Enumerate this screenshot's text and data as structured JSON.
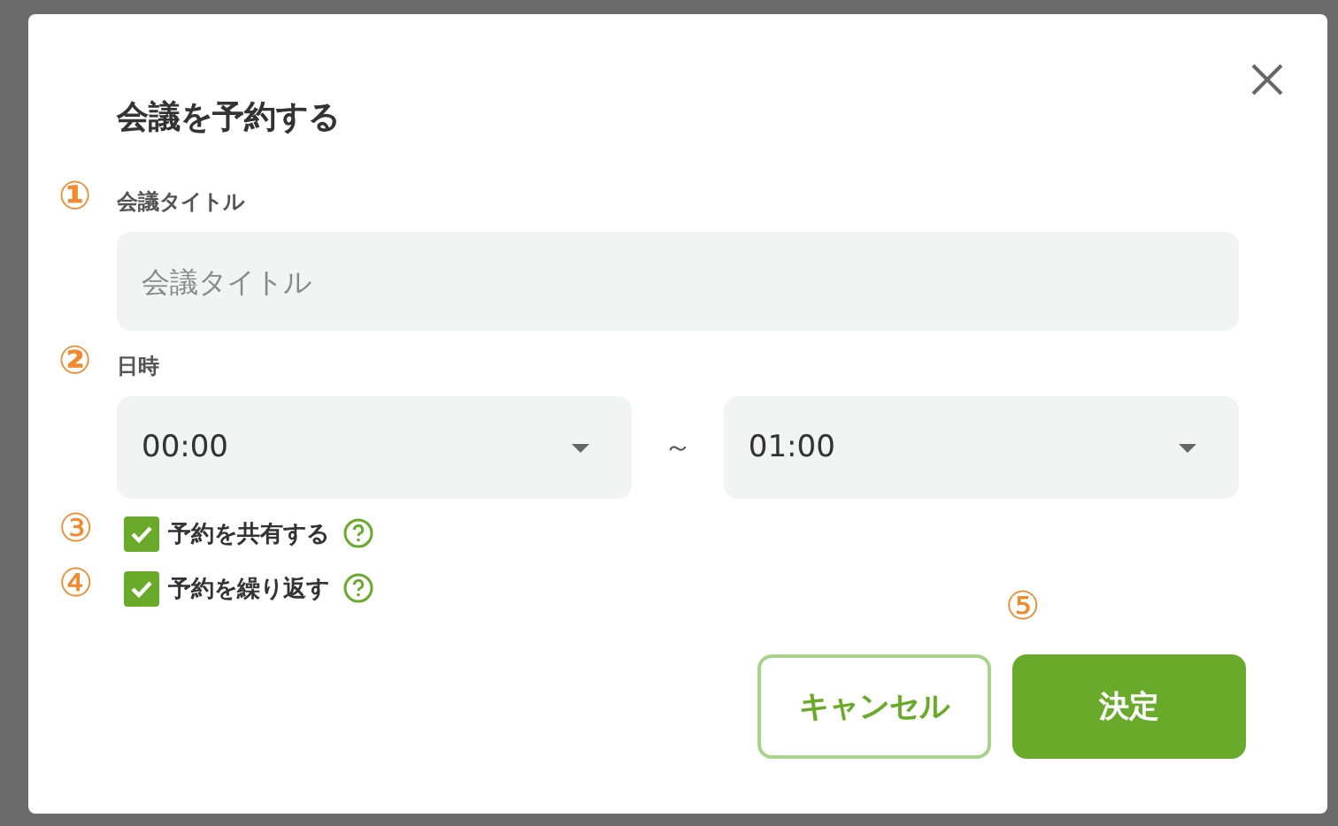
{
  "dialog": {
    "title": "会議を予約する"
  },
  "title_field": {
    "marker": "①",
    "label": "会議タイトル",
    "placeholder": "会議タイトル"
  },
  "datetime": {
    "marker": "②",
    "label": "日時",
    "start": "00:00",
    "separator": "～",
    "end": "01:00"
  },
  "options": [
    {
      "marker": "③",
      "label": "予約を共有する",
      "checked": true
    },
    {
      "marker": "④",
      "label": "予約を繰り返す",
      "checked": true
    }
  ],
  "actions_marker": "⑤",
  "buttons": [
    {
      "label": "キャンセル",
      "kind": "secondary"
    },
    {
      "label": "決定",
      "kind": "primary"
    }
  ]
}
